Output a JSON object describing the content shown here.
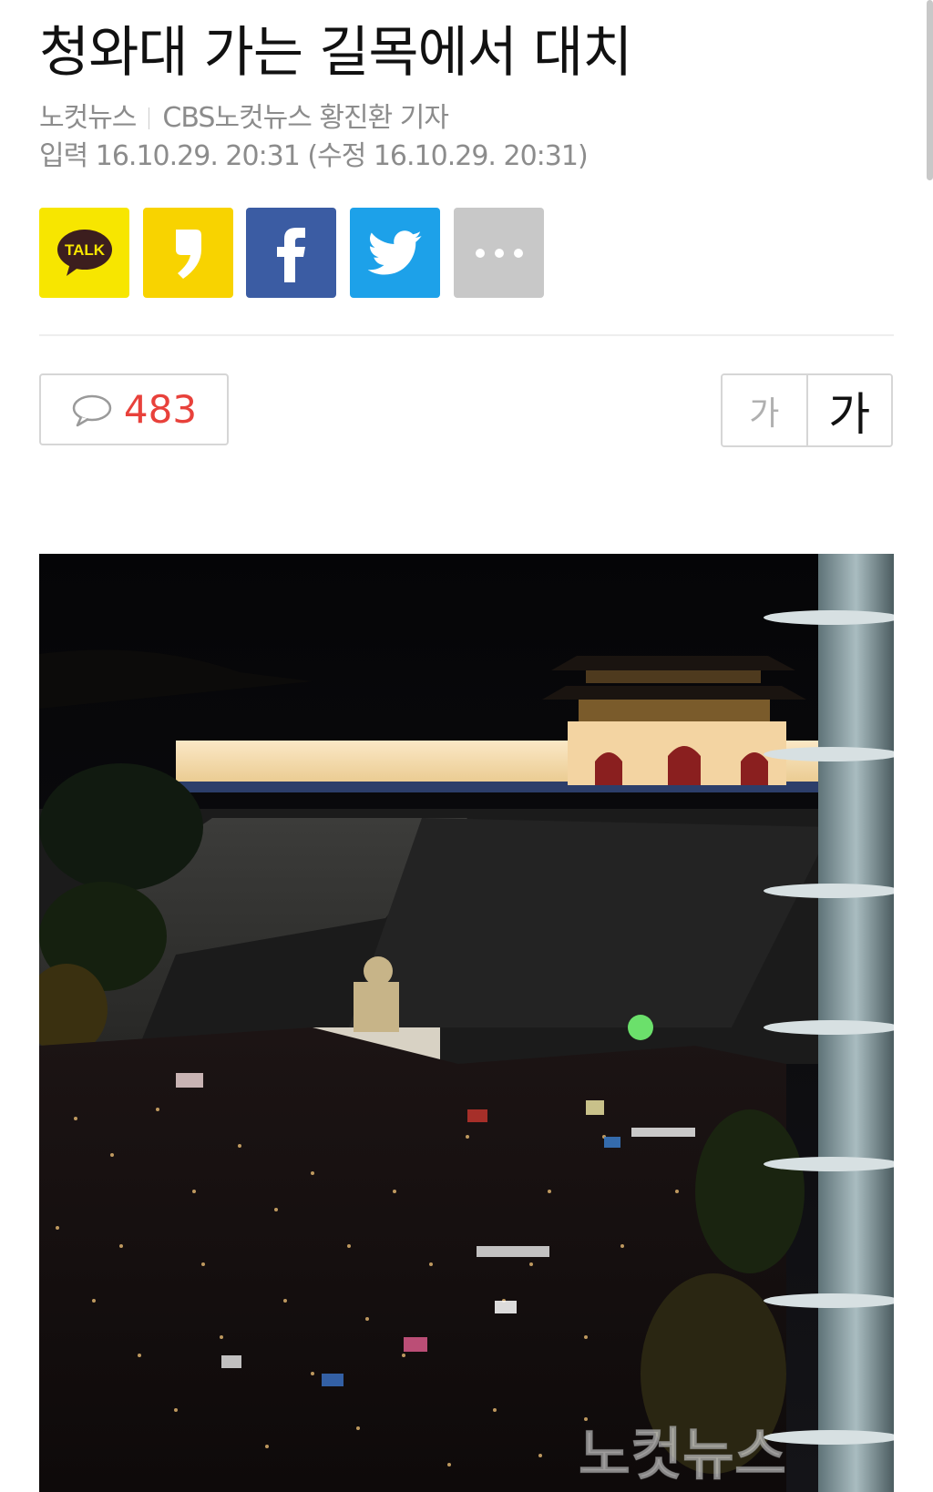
{
  "article": {
    "headline": "청와대 가는 길목에서 대치",
    "source": "노컷뉴스",
    "reporter": "CBS노컷뉴스 황진환 기자",
    "dateline": "입력 16.10.29. 20:31 (수정 16.10.29. 20:31)"
  },
  "share": {
    "buttons": [
      {
        "name": "kakaotalk",
        "label": "TALK",
        "color": "#f7e600",
        "icon": "kakaotalk-icon"
      },
      {
        "name": "kakaostory",
        "label": "",
        "color": "#f8d300",
        "icon": "kakaostory-icon"
      },
      {
        "name": "facebook",
        "label": "",
        "color": "#3b5ca3",
        "icon": "facebook-icon"
      },
      {
        "name": "twitter",
        "label": "",
        "color": "#1da1e9",
        "icon": "twitter-icon"
      },
      {
        "name": "more",
        "label": "",
        "color": "#c8c8c8",
        "icon": "more-dots-icon"
      }
    ]
  },
  "comments": {
    "count": "483",
    "icon": "speech-bubble-icon",
    "count_color": "#e8413b"
  },
  "font_size": {
    "smaller_label": "가",
    "larger_label": "가"
  },
  "photo": {
    "watermark": "노컷뉴스"
  }
}
